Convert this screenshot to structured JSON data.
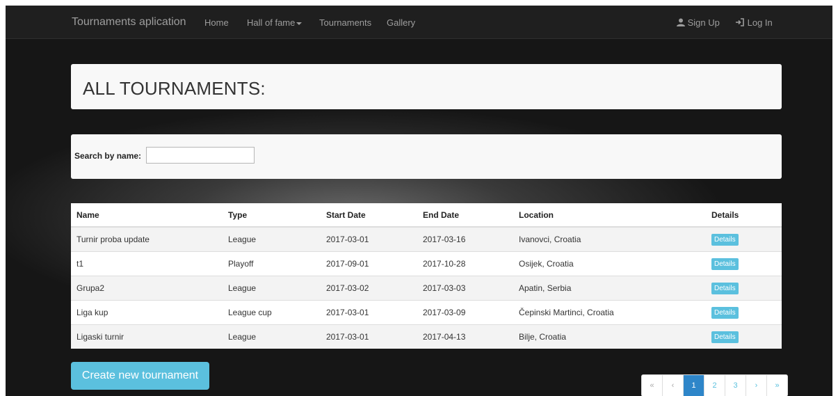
{
  "navbar": {
    "brand": "Tournaments aplication",
    "links": [
      "Home",
      "Hall of fame",
      "Tournaments",
      "Gallery"
    ],
    "sign_up": "Sign Up",
    "log_in": "Log In"
  },
  "header": {
    "title": "ALL TOURNAMENTS:"
  },
  "search": {
    "label": "Search by name:",
    "value": "",
    "placeholder": ""
  },
  "table": {
    "columns": [
      "Name",
      "Type",
      "Start Date",
      "End Date",
      "Location",
      "Details"
    ],
    "rows": [
      {
        "name": "Turnir proba update",
        "type": "League",
        "start": "2017-03-01",
        "end": "2017-03-16",
        "location": "Ivanovci, Croatia",
        "details": "Details"
      },
      {
        "name": "t1",
        "type": "Playoff",
        "start": "2017-09-01",
        "end": "2017-10-28",
        "location": "Osijek, Croatia",
        "details": "Details"
      },
      {
        "name": "Grupa2",
        "type": "League",
        "start": "2017-03-02",
        "end": "2017-03-03",
        "location": "Apatin, Serbia",
        "details": "Details"
      },
      {
        "name": "Liga kup",
        "type": "League cup",
        "start": "2017-03-01",
        "end": "2017-03-09",
        "location": "Čepinski Martinci, Croatia",
        "details": "Details"
      },
      {
        "name": "Ligaski turnir",
        "type": "League",
        "start": "2017-03-01",
        "end": "2017-04-13",
        "location": "Bilje, Croatia",
        "details": "Details"
      }
    ]
  },
  "create_button": "Create new tournament",
  "pagination": {
    "first": "«",
    "prev": "‹",
    "pages": [
      "1",
      "2",
      "3"
    ],
    "next": "›",
    "last": "»",
    "current": "1"
  },
  "colors": {
    "accent": "#5bc0de",
    "active_page": "#2e86c9",
    "navbar": "#1f1f1f"
  }
}
